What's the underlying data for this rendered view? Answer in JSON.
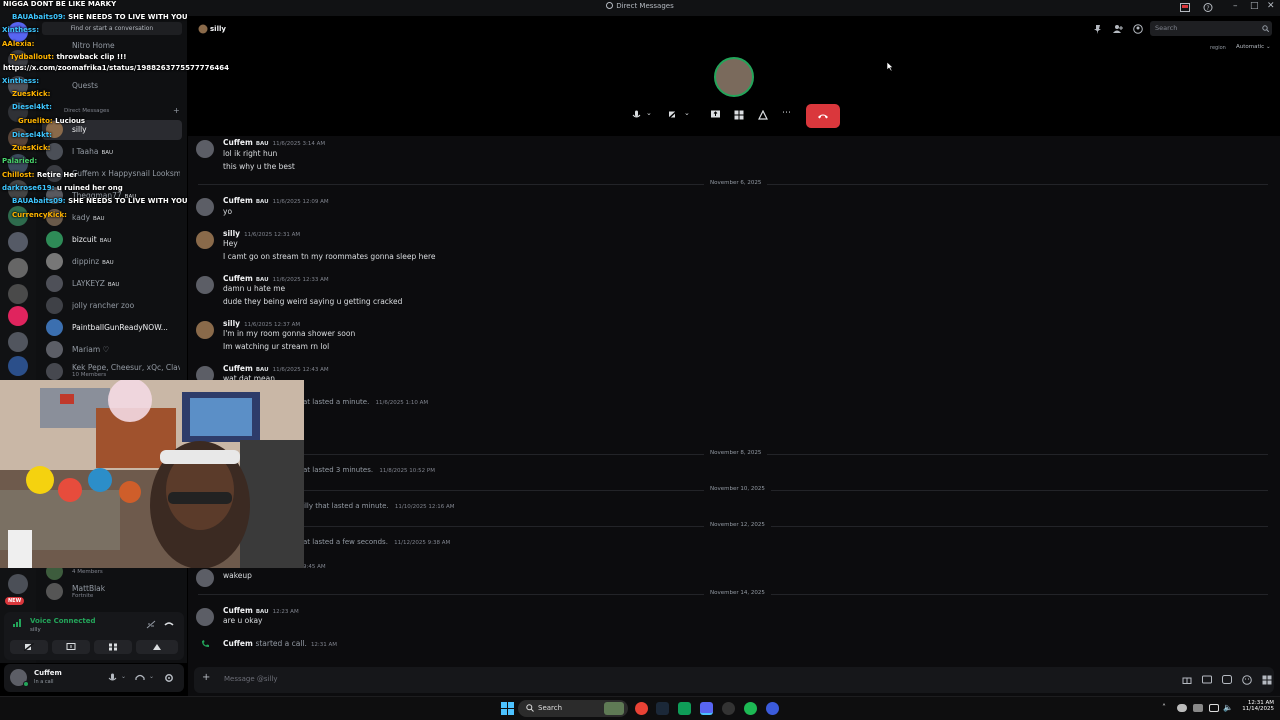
{
  "window": {
    "title": "Direct Messages"
  },
  "stream_overlay": {
    "banner": "NIGGA DONT BE LIKE MARKY",
    "link": "https://x.com/zoomafrika1/status/1988263775577776464",
    "chat": [
      {
        "user": "BAUAbaits09:",
        "text": "SHE NEEDS TO LIVE WITH YOU"
      },
      {
        "user": "Xinthess:",
        "text": ""
      },
      {
        "user": "AAlexia:",
        "text": ""
      },
      {
        "user": "Tydballout:",
        "text": "throwback clip !!!"
      },
      {
        "user": "Xinthess:",
        "text": ""
      },
      {
        "user": "ZuesKick:",
        "text": ""
      },
      {
        "user": "Diesel4kt:",
        "text": ""
      },
      {
        "user": "Gruelito:",
        "text": "Lucious"
      },
      {
        "user": "Diesel4kt:",
        "text": ""
      },
      {
        "user": "ZuesKick:",
        "text": ""
      },
      {
        "user": "Palaried:",
        "text": ""
      },
      {
        "user": "Chillost:",
        "text": "Retire Her"
      },
      {
        "user": "darkrose619:",
        "text": "u ruined her ong"
      },
      {
        "user": "BAUAbaits09:",
        "text": "SHE NEEDS TO LIVE WITH YOU"
      },
      {
        "user": "CurrencyKick:",
        "text": ""
      }
    ]
  },
  "sidebar": {
    "find_label": "Find or start a conversation",
    "nitro_label": "Nitro Home",
    "quests_label": "Quests",
    "dm_header": "Direct Messages",
    "items": [
      {
        "name": "silly",
        "sub": ""
      },
      {
        "name": "I Taaha",
        "sub": ""
      },
      {
        "name": "Cuffem x Happysnail Looksm...",
        "sub": ""
      },
      {
        "name": "Theggman77",
        "sub": ""
      },
      {
        "name": "kady",
        "sub": ""
      },
      {
        "name": "bizcuit",
        "sub": ""
      },
      {
        "name": "dippinz",
        "sub": ""
      },
      {
        "name": "LAYKEYZ",
        "sub": ""
      },
      {
        "name": "jolly rancher zoo",
        "sub": ""
      },
      {
        "name": "PaintballGunReadyNOW...",
        "sub": ""
      },
      {
        "name": "Mariam ♡",
        "sub": ""
      },
      {
        "name": "Kek Pepe, Cheesur, xQc, Clavi...",
        "sub": "10 Members"
      },
      {
        "name": "",
        "sub": "4 Members"
      },
      {
        "name": "MattBlak",
        "sub": "Fortnite"
      }
    ],
    "bau_label": "BAU",
    "new_badge": "NEW"
  },
  "voice_panel": {
    "status": "Voice Connected",
    "channel": "silly"
  },
  "user_panel": {
    "name": "Cuffem",
    "status": "In a call"
  },
  "header": {
    "channel_name": "silly",
    "search_placeholder": "Search",
    "region_label": "region",
    "region_value": "Automatic"
  },
  "chat": {
    "messages": [
      {
        "author": "Cuffem",
        "badge": "BAU",
        "time": "11/6/2025 3:14 AM",
        "lines": [
          "lol ik right hun",
          "this why u the best"
        ]
      },
      {
        "author": "Cuffem",
        "badge": "BAU",
        "time": "11/6/2025 12:09 AM",
        "lines": [
          "yo"
        ]
      },
      {
        "author": "silly",
        "badge": "",
        "time": "11/6/2025 12:31 AM",
        "lines": [
          "Hey",
          "I camt go on stream tn my roommates gonna sleep here"
        ]
      },
      {
        "author": "Cuffem",
        "badge": "BAU",
        "time": "11/6/2025 12:33 AM",
        "lines": [
          "damn u hate me",
          "dude they being weird saying u getting cracked"
        ]
      },
      {
        "author": "silly",
        "badge": "",
        "time": "11/6/2025 12:37 AM",
        "lines": [
          "I'm in my room gonna shower soon",
          "Im watching ur stream rn lol"
        ]
      },
      {
        "author": "Cuffem",
        "badge": "BAU",
        "time": "11/6/2025 12:43 AM",
        "lines": [
          "wat dat mean"
        ]
      }
    ],
    "system": [
      {
        "text": "at lasted a minute.",
        "time": "11/6/2025 1:10 AM"
      },
      {
        "text": "at lasted 3 minutes.",
        "time": "11/8/2025 10:52 PM"
      },
      {
        "text": "illy that lasted a minute.",
        "time": "11/10/2025 12:16 AM"
      },
      {
        "text": "at lasted a few seconds.",
        "time": "11/12/2025 9:38 AM"
      }
    ],
    "dates": [
      "November 6, 2025",
      "November 8, 2025",
      "November 10, 2025",
      "November 12, 2025",
      "November 14, 2025"
    ],
    "wakeup": {
      "time": "9:45 AM",
      "text": "wakeup"
    },
    "last_msg": {
      "author": "Cuffem",
      "badge": "BAU",
      "time": "12:23 AM",
      "text": "are u okay"
    },
    "call_started": {
      "author": "Cuffem",
      "text": "started a call.",
      "time": "12:31 AM"
    }
  },
  "composer": {
    "placeholder": "Message @silly"
  },
  "taskbar": {
    "search_label": "Search",
    "time": "12:31 AM",
    "date": "11/14/2025"
  },
  "colors": {
    "hangup": "#da373c",
    "accent_green": "#23a55a",
    "bg_main": "#0c0c0e"
  }
}
